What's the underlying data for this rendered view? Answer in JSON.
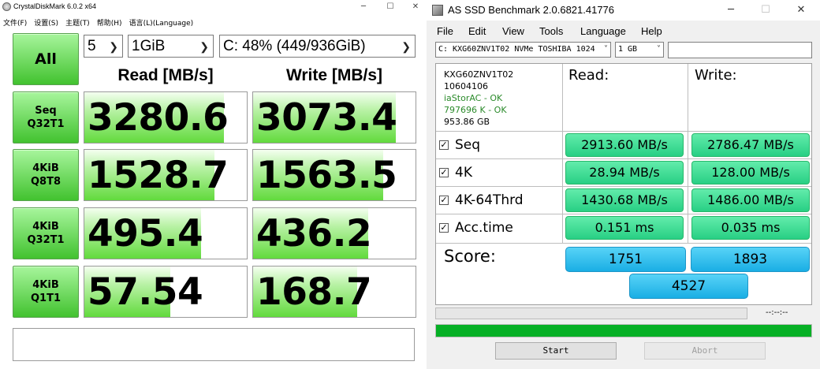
{
  "cdm": {
    "title": "CrystalDiskMark 6.0.2 x64",
    "menu": [
      "文件(F)",
      "设置(S)",
      "主题(T)",
      "帮助(H)",
      "语言(L)(Language)"
    ],
    "all_label": "All",
    "count_select": "5",
    "size_select": "1GiB",
    "drive_select": "C: 48% (449/936GiB)",
    "read_header": "Read [MB/s]",
    "write_header": "Write [MB/s]",
    "tests": [
      {
        "line1": "Seq",
        "line2": "Q32T1",
        "read": "3280.6",
        "write": "3073.4",
        "read_fill": 0.86,
        "write_fill": 0.88
      },
      {
        "line1": "4KiB",
        "line2": "Q8T8",
        "read": "1528.7",
        "write": "1563.5",
        "read_fill": 0.8,
        "write_fill": 0.8
      },
      {
        "line1": "4KiB",
        "line2": "Q32T1",
        "read": "495.4",
        "write": "436.2",
        "read_fill": 0.72,
        "write_fill": 0.71
      },
      {
        "line1": "4KiB",
        "line2": "Q1T1",
        "read": "57.54",
        "write": "168.7",
        "read_fill": 0.53,
        "write_fill": 0.64
      }
    ],
    "colors": {
      "accent": "#42c22f"
    }
  },
  "asssd": {
    "title": "AS SSD Benchmark 2.0.6821.41776",
    "menu": [
      "File",
      "Edit",
      "View",
      "Tools",
      "Language",
      "Help"
    ],
    "drive_select": "C: KXG60ZNV1T02 NVMe TOSHIBA 1024",
    "size_select": "1 GB",
    "info": {
      "model": "KXG60ZNV1T02",
      "firmware": "10604106",
      "driver": "iaStorAC - OK",
      "alignment": "797696 K - OK",
      "capacity": "953.86 GB"
    },
    "read_header": "Read:",
    "write_header": "Write:",
    "rows": [
      {
        "label": "Seq",
        "read": "2913.60 MB/s",
        "write": "2786.47 MB/s"
      },
      {
        "label": "4K",
        "read": "28.94 MB/s",
        "write": "128.00 MB/s"
      },
      {
        "label": "4K-64Thrd",
        "read": "1430.68 MB/s",
        "write": "1486.00 MB/s"
      },
      {
        "label": "Acc.time",
        "read": "0.151 ms",
        "write": "0.035 ms"
      }
    ],
    "score_label": "Score:",
    "score_read": "1751",
    "score_write": "1893",
    "score_total": "4527",
    "time_display": "--:--:--",
    "progress_fill": 1.0,
    "start_label": "Start",
    "abort_label": "Abort",
    "colors": {
      "green_pill": "#28cf84",
      "blue_pill": "#1aaee4",
      "progress": "#06b025"
    }
  }
}
